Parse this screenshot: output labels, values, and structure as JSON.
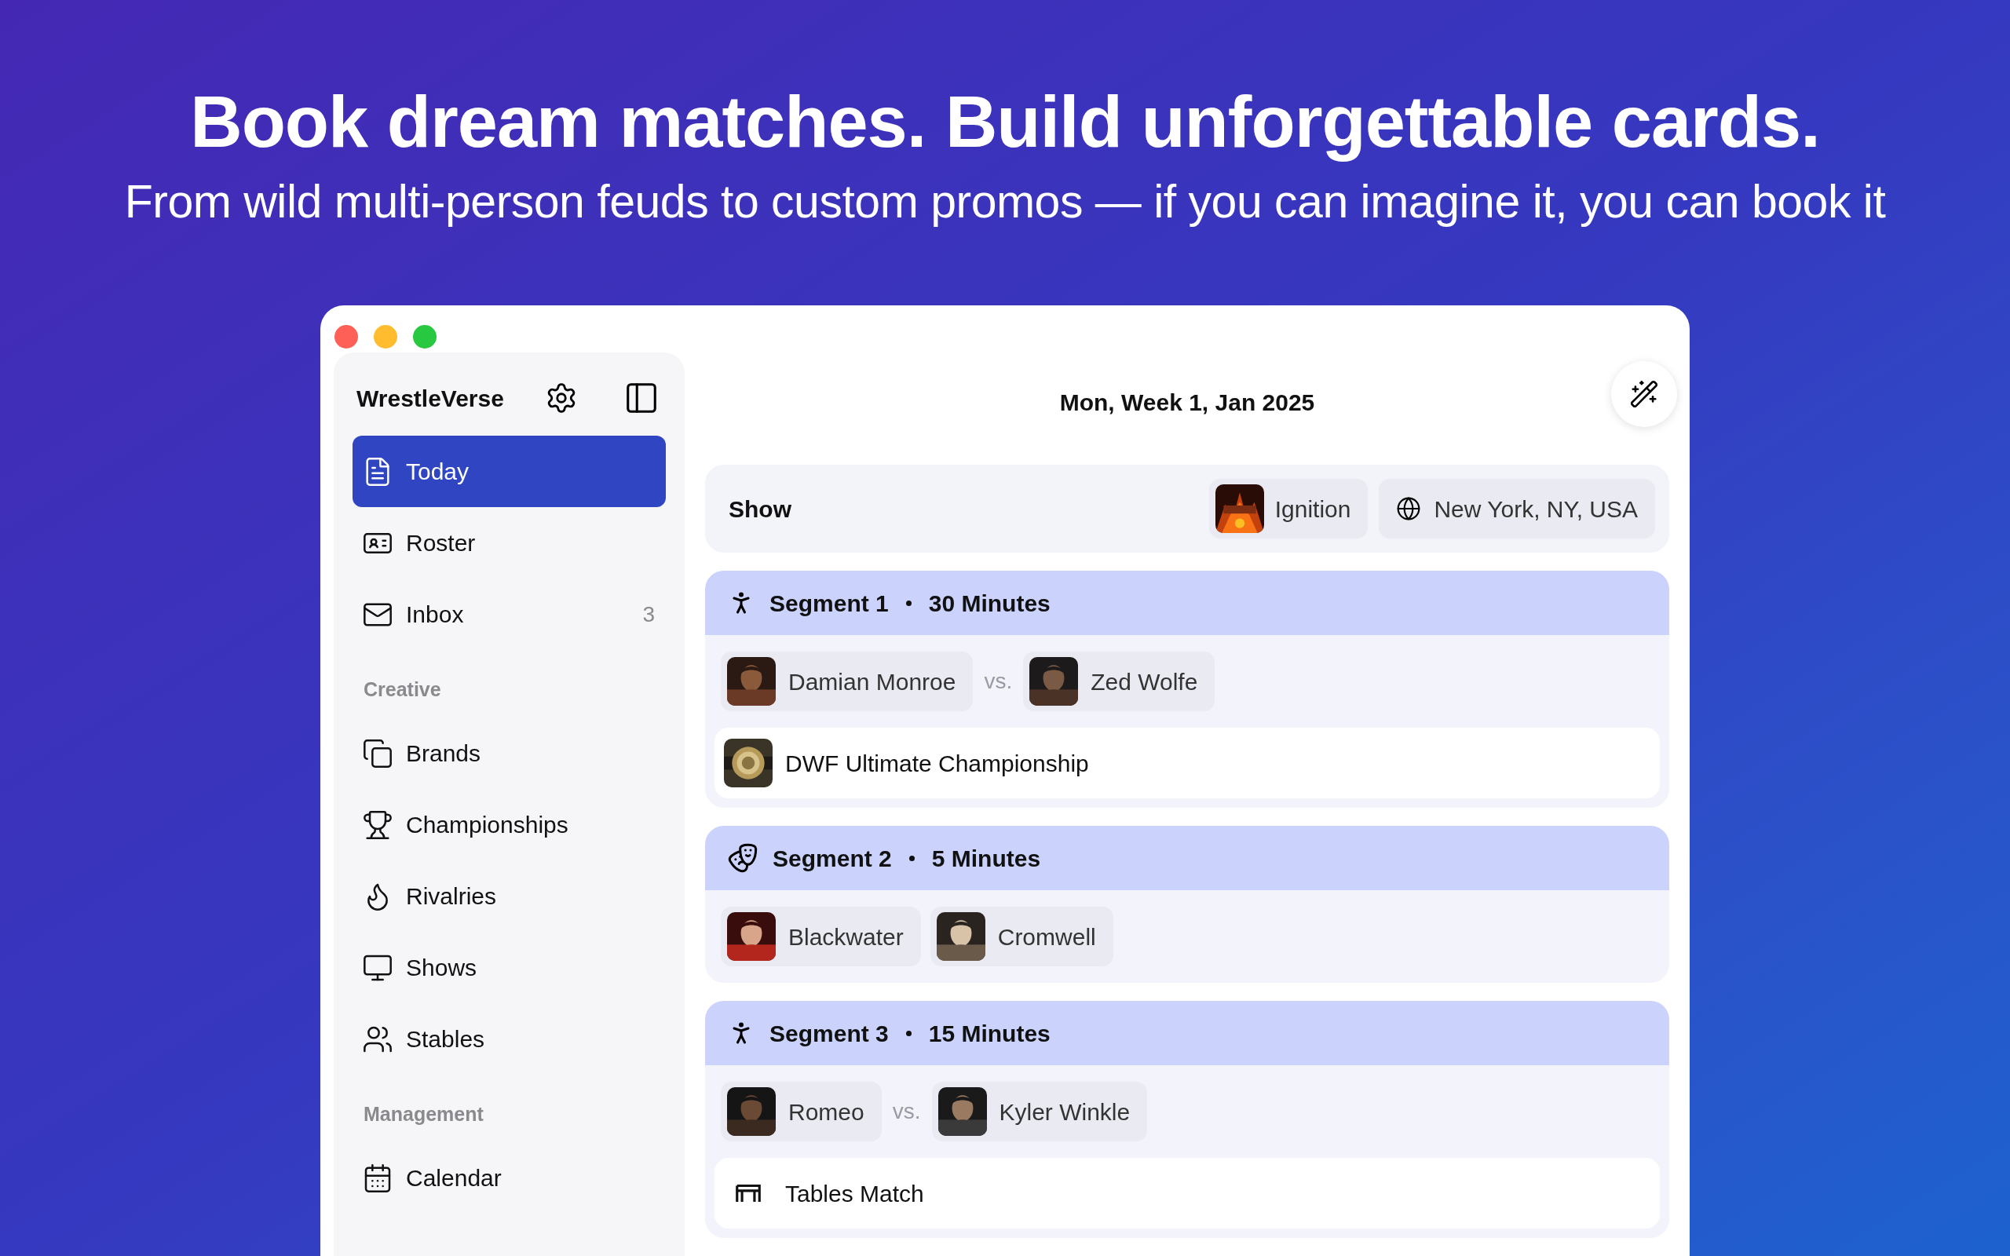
{
  "headline": "Book dream matches. Build unforgettable cards.",
  "subheadline": "From wild multi-person feuds to custom promos — if you can imagine it, you can book it",
  "sidebar": {
    "app_name": "WrestleVerse",
    "sections": [
      {
        "items": [
          {
            "label": "Today",
            "selected": true
          },
          {
            "label": "Roster",
            "selected": false
          },
          {
            "label": "Inbox",
            "selected": false,
            "count": "3"
          }
        ]
      },
      {
        "heading": "Creative",
        "items": [
          {
            "label": "Brands",
            "selected": false
          },
          {
            "label": "Championships",
            "selected": false
          },
          {
            "label": "Rivalries",
            "selected": false
          },
          {
            "label": "Shows",
            "selected": false
          },
          {
            "label": "Stables",
            "selected": false
          }
        ]
      },
      {
        "heading": "Management",
        "items": [
          {
            "label": "Calendar",
            "selected": false
          }
        ]
      }
    ]
  },
  "main": {
    "date": "Mon, Week 1, Jan 2025",
    "show": {
      "label": "Show",
      "name": "Ignition",
      "location": "New York, NY, USA"
    },
    "segments": [
      {
        "kind": "match",
        "title": "Segment 1",
        "duration": "30 Minutes",
        "participants": [
          "Damian Monroe",
          "Zed Wolfe"
        ],
        "separator": "vs.",
        "detail": {
          "kind": "title",
          "text": "DWF Ultimate Championship"
        }
      },
      {
        "kind": "promo",
        "title": "Segment 2",
        "duration": "5 Minutes",
        "participants": [
          "Blackwater",
          "Cromwell"
        ]
      },
      {
        "kind": "match",
        "title": "Segment 3",
        "duration": "15 Minutes",
        "participants": [
          "Romeo",
          "Kyler Winkle"
        ],
        "separator": "vs.",
        "detail": {
          "kind": "stipulation",
          "text": "Tables Match"
        }
      }
    ]
  }
}
